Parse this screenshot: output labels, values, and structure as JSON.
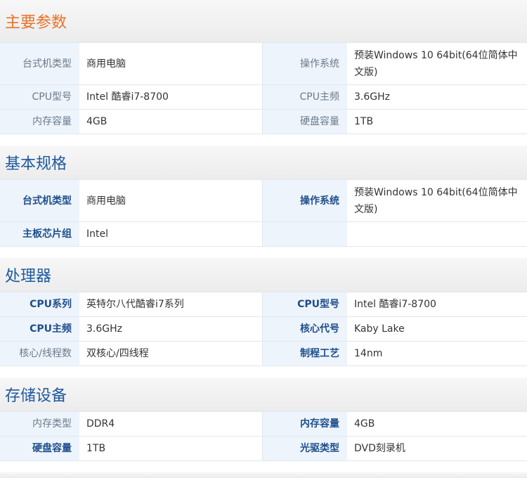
{
  "sections": [
    {
      "title": "主要参数",
      "rows": [
        {
          "k1": "台式机类型",
          "v1": "商用电脑",
          "k2": "操作系统",
          "v2": "预装Windows 10 64bit(64位简体中文版)"
        },
        {
          "k1": "CPU型号",
          "v1": "Intel 酷睿i7-8700",
          "k2": "CPU主频",
          "v2": "3.6GHz"
        },
        {
          "k1": "内存容量",
          "v1": "4GB",
          "k2": "硬盘容量",
          "v2": "1TB"
        }
      ]
    },
    {
      "title": "基本规格",
      "rows": [
        {
          "k1": "台式机类型",
          "v1": "商用电脑",
          "k2": "操作系统",
          "v2": "预装Windows 10 64bit(64位简体中文版)"
        },
        {
          "k1": "主板芯片组",
          "v1": "Intel",
          "k2": "",
          "v2": ""
        }
      ]
    },
    {
      "title": "处理器",
      "rows": [
        {
          "k1": "CPU系列",
          "v1": "英特尔八代酷睿i7系列",
          "k2": "CPU型号",
          "v2": "Intel 酷睿i7-8700"
        },
        {
          "k1": "CPU主频",
          "v1": "3.6GHz",
          "k2": "核心代号",
          "v2": "Kaby Lake"
        },
        {
          "k1": "核心/线程数",
          "v1": "双核心/四线程",
          "k2": "制程工艺",
          "v2": "14nm"
        }
      ]
    },
    {
      "title": "存储设备",
      "rows": [
        {
          "k1": "内存类型",
          "v1": "DDR4",
          "k2": "内存容量",
          "v2": "4GB"
        },
        {
          "k1": "硬盘容量",
          "v1": "1TB",
          "k2": "光驱类型",
          "v2": "DVD刻录机"
        }
      ]
    }
  ]
}
